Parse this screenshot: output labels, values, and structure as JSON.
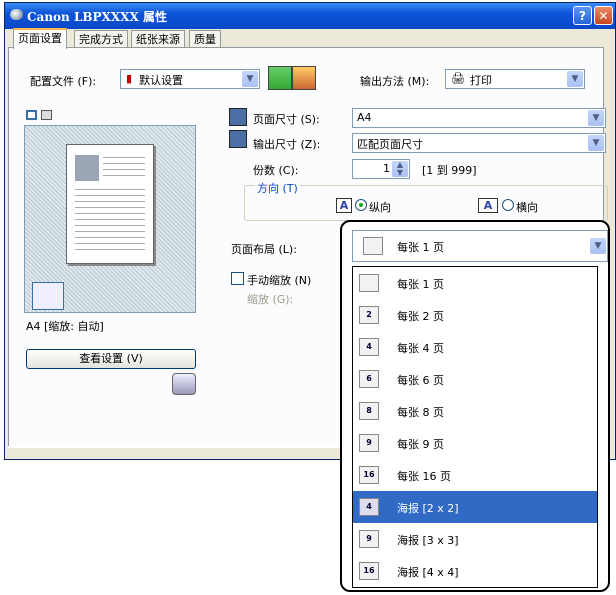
{
  "window": {
    "title": "Canon LBPXXXX 属性",
    "help": "?",
    "close": "✕"
  },
  "tabs": [
    "页面设置",
    "完成方式",
    "纸张来源",
    "质量"
  ],
  "profile": {
    "label": "配置文件 (F):",
    "value": "默认设置"
  },
  "output_method": {
    "label": "输出方法 (M):",
    "value": "打印"
  },
  "page_size": {
    "label": "页面尺寸 (S):",
    "value": "A4"
  },
  "output_size": {
    "label": "输出尺寸 (Z):",
    "value": "匹配页面尺寸"
  },
  "copies": {
    "label": "份数 (C):",
    "value": "1",
    "range": "[1 到 999]"
  },
  "orientation": {
    "label": "方向 (T)",
    "portrait": "纵向",
    "landscape": "横向",
    "selected": "portrait"
  },
  "page_layout": {
    "label": "页面布局 (L):",
    "value": "每张 1 页"
  },
  "manual_scaling": {
    "label": "手动缩放 (N)",
    "checked": false,
    "scale_label": "缩放 (G):"
  },
  "preview": {
    "status": "A4 [缩放: 自动]",
    "view_settings": "查看设置 (V)"
  },
  "layout_options": [
    {
      "label": "每张 1 页",
      "icon": ""
    },
    {
      "label": "每张 2 页",
      "icon": "2"
    },
    {
      "label": "每张 4 页",
      "icon": "4"
    },
    {
      "label": "每张 6 页",
      "icon": "6"
    },
    {
      "label": "每张 8 页",
      "icon": "8"
    },
    {
      "label": "每张 9 页",
      "icon": "9"
    },
    {
      "label": "每张 16 页",
      "icon": "16"
    },
    {
      "label": "海报 [2 x 2]",
      "icon": "4"
    },
    {
      "label": "海报 [3 x 3]",
      "icon": "9"
    },
    {
      "label": "海报 [4 x 4]",
      "icon": "16"
    }
  ],
  "selected_option_index": 7,
  "colors": {
    "titlebar": "#0a48c9",
    "selection": "#316ac5",
    "dialog": "#ece9d8"
  }
}
